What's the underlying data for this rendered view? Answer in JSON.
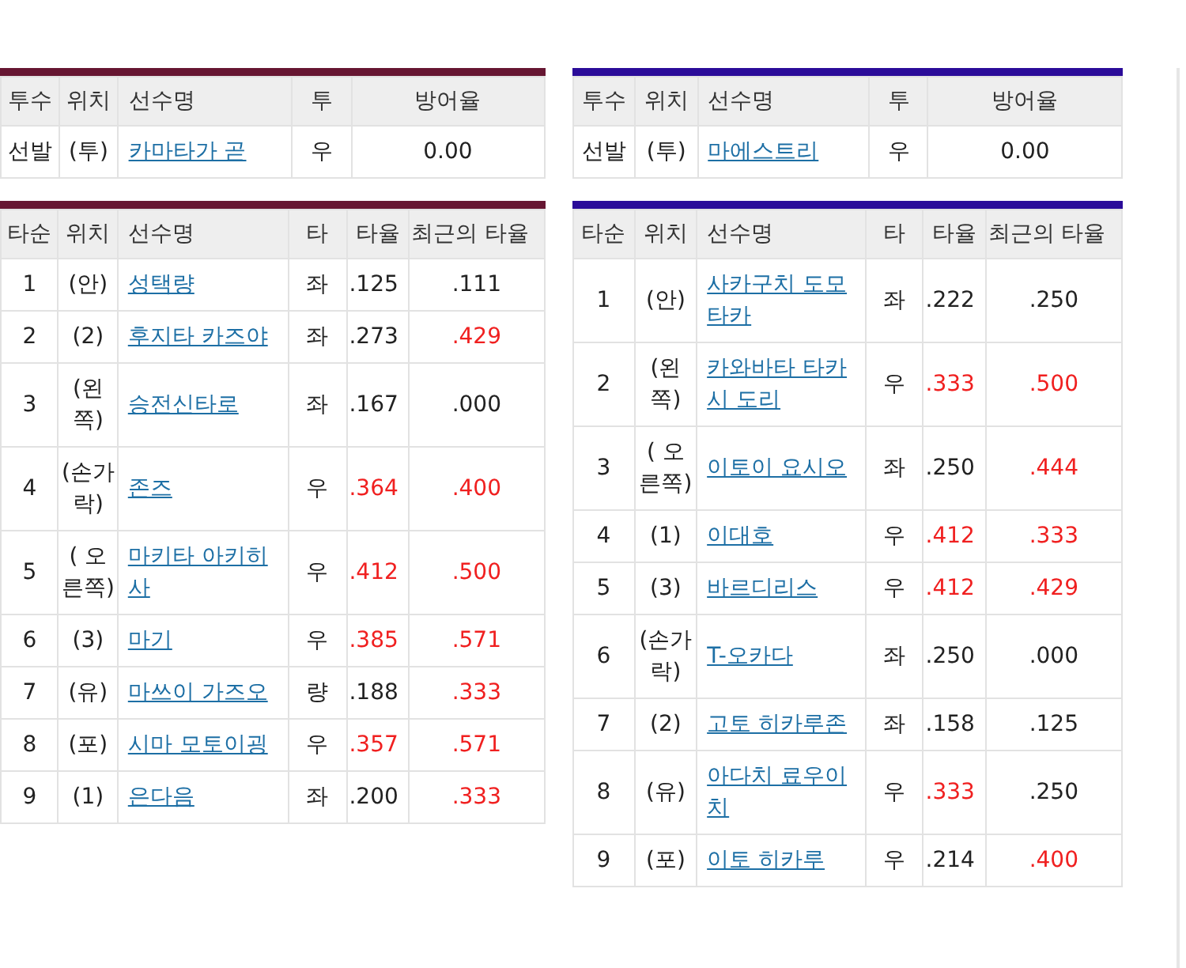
{
  "teams": [
    {
      "color": "#661632",
      "pitchers": {
        "columns": [
          "투수",
          "위치",
          "선수명",
          "투",
          "방어율"
        ],
        "rows": [
          {
            "role": "선발",
            "pos": "(투)",
            "name": "카마타가 곧",
            "hand": "우",
            "era": "0.00"
          }
        ]
      },
      "batters": {
        "columns": [
          "타순",
          "위치",
          "선수명",
          "타",
          "타율",
          "최근의 타율"
        ],
        "rows": [
          {
            "order": "1",
            "pos": "(안)",
            "name": "성택량",
            "hand": "좌",
            "avg": ".125",
            "avg_high": false,
            "recent": ".111",
            "recent_high": false
          },
          {
            "order": "2",
            "pos": "(2)",
            "name": "후지타 카즈야",
            "hand": "좌",
            "avg": ".273",
            "avg_high": false,
            "recent": ".429",
            "recent_high": true
          },
          {
            "order": "3",
            "pos": "(왼쪽)",
            "name": "승전신타로",
            "hand": "좌",
            "avg": ".167",
            "avg_high": false,
            "recent": ".000",
            "recent_high": false
          },
          {
            "order": "4",
            "pos": "(손가락)",
            "name": "존즈",
            "hand": "우",
            "avg": ".364",
            "avg_high": true,
            "recent": ".400",
            "recent_high": true
          },
          {
            "order": "5",
            "pos": "( 오른쪽)",
            "name": "마키타 아키히사",
            "hand": "우",
            "avg": ".412",
            "avg_high": true,
            "recent": ".500",
            "recent_high": true
          },
          {
            "order": "6",
            "pos": "(3)",
            "name": "마기",
            "hand": "우",
            "avg": ".385",
            "avg_high": true,
            "recent": ".571",
            "recent_high": true
          },
          {
            "order": "7",
            "pos": "(유)",
            "name": "마쓰이 가즈오",
            "hand": "량",
            "avg": ".188",
            "avg_high": false,
            "recent": ".333",
            "recent_high": true
          },
          {
            "order": "8",
            "pos": "(포)",
            "name": "시마 모토이굉",
            "hand": "우",
            "avg": ".357",
            "avg_high": true,
            "recent": ".571",
            "recent_high": true
          },
          {
            "order": "9",
            "pos": "(1)",
            "name": "은다음",
            "hand": "좌",
            "avg": ".200",
            "avg_high": false,
            "recent": ".333",
            "recent_high": true
          }
        ]
      }
    },
    {
      "color": "#2b0c99",
      "pitchers": {
        "columns": [
          "투수",
          "위치",
          "선수명",
          "투",
          "방어율"
        ],
        "rows": [
          {
            "role": "선발",
            "pos": "(투)",
            "name": "마에스트리",
            "hand": "우",
            "era": "0.00"
          }
        ]
      },
      "batters": {
        "columns": [
          "타순",
          "위치",
          "선수명",
          "타",
          "타율",
          "최근의 타율"
        ],
        "rows": [
          {
            "order": "1",
            "pos": "(안)",
            "name": "사카구치 도모타카",
            "hand": "좌",
            "avg": ".222",
            "avg_high": false,
            "recent": ".250",
            "recent_high": false
          },
          {
            "order": "2",
            "pos": "(왼쪽)",
            "name": "카와바타 타카시 도리",
            "hand": "우",
            "avg": ".333",
            "avg_high": true,
            "recent": ".500",
            "recent_high": true
          },
          {
            "order": "3",
            "pos": "( 오른쪽)",
            "name": "이토이 요시오",
            "hand": "좌",
            "avg": ".250",
            "avg_high": false,
            "recent": ".444",
            "recent_high": true
          },
          {
            "order": "4",
            "pos": "(1)",
            "name": "이대호",
            "hand": "우",
            "avg": ".412",
            "avg_high": true,
            "recent": ".333",
            "recent_high": true
          },
          {
            "order": "5",
            "pos": "(3)",
            "name": "바르디리스",
            "hand": "우",
            "avg": ".412",
            "avg_high": true,
            "recent": ".429",
            "recent_high": true
          },
          {
            "order": "6",
            "pos": "(손가락)",
            "name": "T-오카다",
            "hand": "좌",
            "avg": ".250",
            "avg_high": false,
            "recent": ".000",
            "recent_high": false
          },
          {
            "order": "7",
            "pos": "(2)",
            "name": "고토 히카루존",
            "hand": "좌",
            "avg": ".158",
            "avg_high": false,
            "recent": ".125",
            "recent_high": false
          },
          {
            "order": "8",
            "pos": "(유)",
            "name": "아다치 료우이치",
            "hand": "우",
            "avg": ".333",
            "avg_high": true,
            "recent": ".250",
            "recent_high": false
          },
          {
            "order": "9",
            "pos": "(포)",
            "name": "이토 히카루",
            "hand": "우",
            "avg": ".214",
            "avg_high": false,
            "recent": ".400",
            "recent_high": true
          }
        ]
      }
    }
  ]
}
